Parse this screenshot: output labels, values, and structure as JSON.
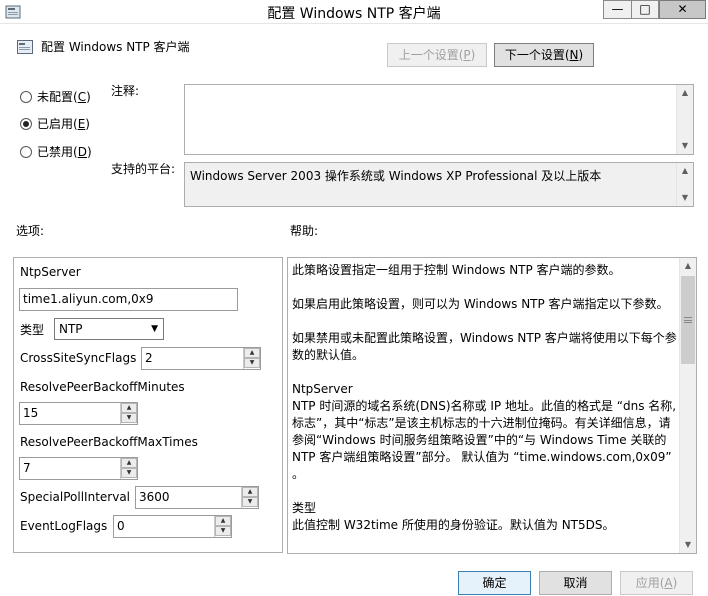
{
  "window": {
    "title": "配置 Windows NTP 客户端",
    "controls": {
      "minimize": "—",
      "maximize": "□",
      "close": "✕"
    }
  },
  "header": {
    "title": "配置 Windows NTP 客户端",
    "prev_label": "上一个设置(",
    "prev_key": "P",
    "next_label": "下一个设置(",
    "next_key": "N"
  },
  "state": {
    "options": [
      {
        "label": "未配置(",
        "key": "C",
        "checked": false
      },
      {
        "label": "已启用(",
        "key": "E",
        "checked": true
      },
      {
        "label": "已禁用(",
        "key": "D",
        "checked": false
      }
    ]
  },
  "comment": {
    "label": "注释:",
    "value": ""
  },
  "supported": {
    "label": "支持的平台:",
    "value": "Windows Server 2003 操作系统或 Windows XP Professional 及以上版本"
  },
  "options_panel": {
    "label": "选项:",
    "ntpserver_label": "NtpServer",
    "ntpserver_value": "time1.aliyun.com,0x9",
    "type_label": "类型",
    "type_value": "NTP",
    "crosssite_label": "CrossSiteSyncFlags",
    "crosssite_value": "2",
    "peerbackoffmin_label": "ResolvePeerBackoffMinutes",
    "peerbackoffmin_value": "15",
    "peerbackoffmax_label": "ResolvePeerBackoffMaxTimes",
    "peerbackoffmax_value": "7",
    "specialpoll_label": "SpecialPollInterval",
    "specialpoll_value": "3600",
    "eventlog_label": "EventLogFlags",
    "eventlog_value": "0"
  },
  "help_panel": {
    "label": "帮助:",
    "paragraphs": [
      "此策略设置指定一组用于控制 Windows NTP 客户端的参数。",
      "如果启用此策略设置，则可以为 Windows NTP 客户端指定以下参数。",
      "如果禁用或未配置此策略设置，Windows NTP 客户端将使用以下每个参数的默认值。",
      "NtpServer\nNTP 时间源的域名系统(DNS)名称或 IP 地址。此值的格式是 “dns 名称,标志”，其中“标志”是该主机标志的十六进制位掩码。有关详细信息，请参阅“Windows 时间服务组策略设置”中的“与 Windows Time 关联的 NTP 客户端组策略设置”部分。 默认值为 “time.windows.com,0x09” 。",
      "类型\n此值控制 W32time 所使用的身份验证。默认值为 NT5DS。"
    ]
  },
  "footer": {
    "ok": "确定",
    "cancel": "取消",
    "apply_label": "应用(",
    "apply_key": "A"
  }
}
